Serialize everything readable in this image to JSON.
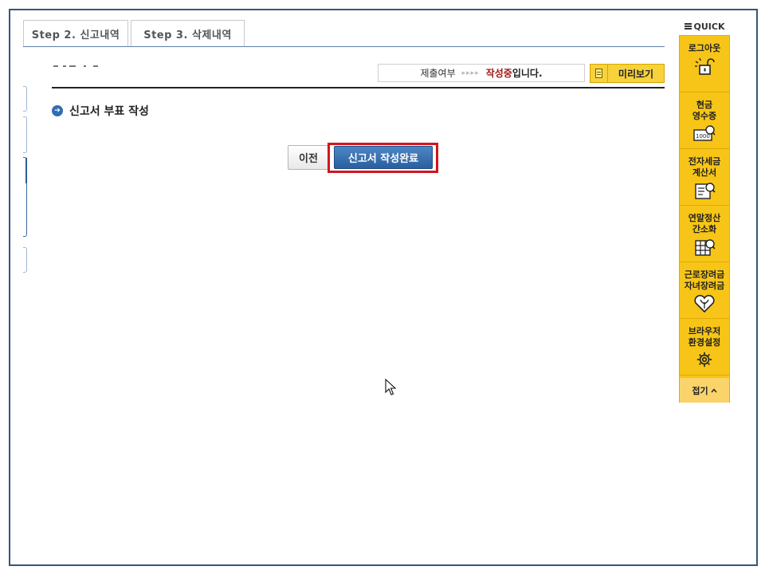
{
  "tabs": [
    {
      "label": "Step 2. 신고내역"
    },
    {
      "label": "Step 3. 삭제내역"
    }
  ],
  "status": {
    "label": "제출여부",
    "arrows": "▸▸▸▸",
    "emphasis": "작성중",
    "suffix": "입니다."
  },
  "preview_label": "미리보기",
  "section": {
    "bullet": "➔",
    "title": "신고서 부표 작성"
  },
  "buttons": {
    "prev": "이전",
    "complete": "신고서 작성완료"
  },
  "quick": {
    "header": "QUICK",
    "items": [
      {
        "label": "로그아웃",
        "icon": "unlock-icon"
      },
      {
        "label": "현금\n영수증",
        "icon": "cash-receipt-icon"
      },
      {
        "label": "전자세금\n계산서",
        "icon": "e-invoice-icon"
      },
      {
        "label": "연말정산\n간소화",
        "icon": "year-end-tax-icon"
      },
      {
        "label": "근로장려금\n자녀장려금",
        "icon": "incentive-heart-icon"
      },
      {
        "label": "브라우저\n환경설정",
        "icon": "gear-icon"
      }
    ],
    "fold": "접기",
    "fold_icon": "chevron-up-icon",
    "cash_icon_text": "1000"
  },
  "colors": {
    "frame": "#3a5473",
    "accent_blue": "#2a5f9f",
    "highlight_red": "#d4141c",
    "quick_yellow": "#f7c517",
    "status_emphasis": "#a01919"
  }
}
